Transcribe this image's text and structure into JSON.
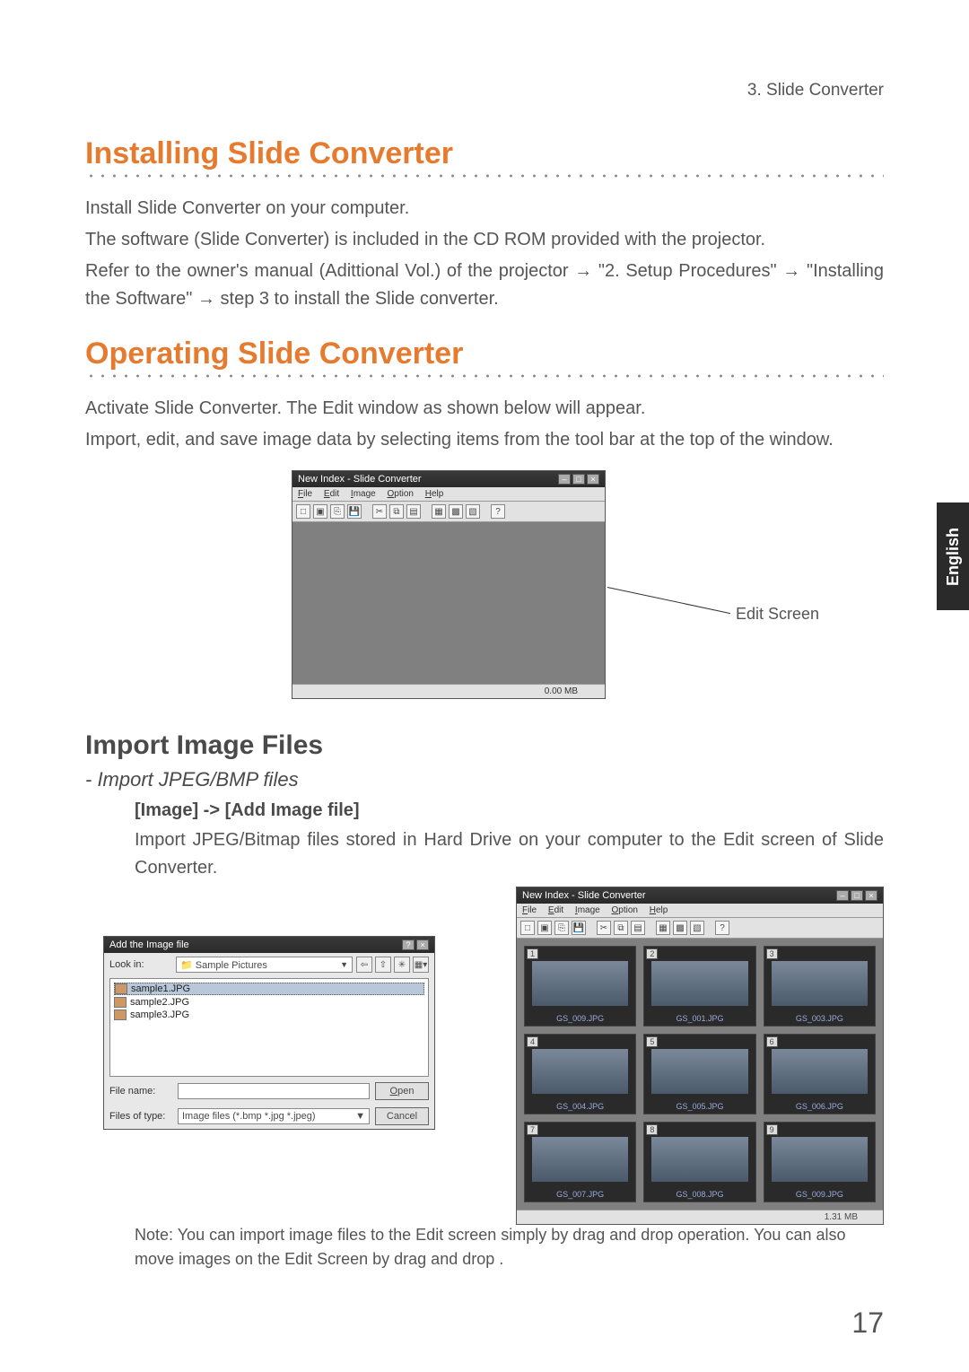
{
  "header": {
    "section": "3. Slide Converter"
  },
  "section_install": {
    "title": "Installing Slide Converter",
    "p1": "Install Slide Converter on your computer.",
    "p2": "The software (Slide Converter) is included in the CD ROM provided with the projector.",
    "p3a": "Refer to the owner's manual (Adittional Vol.) of the projector ",
    "arrow": "→",
    "p3b": " \"2. Setup Procedures\" ",
    "p3c": " \"Installing the Software\" ",
    "p3d": " step 3 to install the Slide converter."
  },
  "section_operate": {
    "title": "Operating Slide Converter",
    "p1": "Activate Slide Converter.  The Edit window as shown below will appear.",
    "p2": "Import, edit, and save image data by selecting items from the tool bar at the top of the window."
  },
  "edit_window": {
    "title": "New Index - Slide Converter",
    "menus": {
      "file": "File",
      "edit": "Edit",
      "image": "Image",
      "option": "Option",
      "help": "Help"
    },
    "status": "0.00 MB",
    "callout": "Edit Screen"
  },
  "section_import": {
    "title": "Import Image Files",
    "sub_italic": "- Import JPEG/BMP files",
    "sub_bold": "[Image] -> [Add Image file]",
    "p1": "Import JPEG/Bitmap files stored in Hard Drive on your computer to the Edit screen of Slide Converter.",
    "note": "Note: You can import image files to the Edit screen simply by drag and drop operation.  You can also move images on the Edit Screen by drag and drop ."
  },
  "file_dialog": {
    "title": "Add the Image file",
    "lookin_label": "Look in:",
    "lookin_value": "Sample Pictures",
    "files": [
      "sample1.JPG",
      "sample2.JPG",
      "sample3.JPG"
    ],
    "filename_label": "File name:",
    "filename_value": "",
    "filetype_label": "Files of type:",
    "filetype_value": "Image files (*.bmp *.jpg *.jpeg)",
    "open": "Open",
    "cancel": "Cancel"
  },
  "grid_window": {
    "title": "New Index - Slide Converter",
    "menus": {
      "file": "File",
      "edit": "Edit",
      "image": "Image",
      "option": "Option",
      "help": "Help"
    },
    "thumbs": [
      {
        "n": "1",
        "cap": "GS_009.JPG"
      },
      {
        "n": "2",
        "cap": "GS_001.JPG"
      },
      {
        "n": "3",
        "cap": "GS_003.JPG"
      },
      {
        "n": "4",
        "cap": "GS_004.JPG"
      },
      {
        "n": "5",
        "cap": "GS_005.JPG"
      },
      {
        "n": "6",
        "cap": "GS_006.JPG"
      },
      {
        "n": "7",
        "cap": "GS_007.JPG"
      },
      {
        "n": "8",
        "cap": "GS_008.JPG"
      },
      {
        "n": "9",
        "cap": "GS_009.JPG"
      }
    ],
    "status": "1.31 MB"
  },
  "side_tab": "English",
  "page_number": "17"
}
